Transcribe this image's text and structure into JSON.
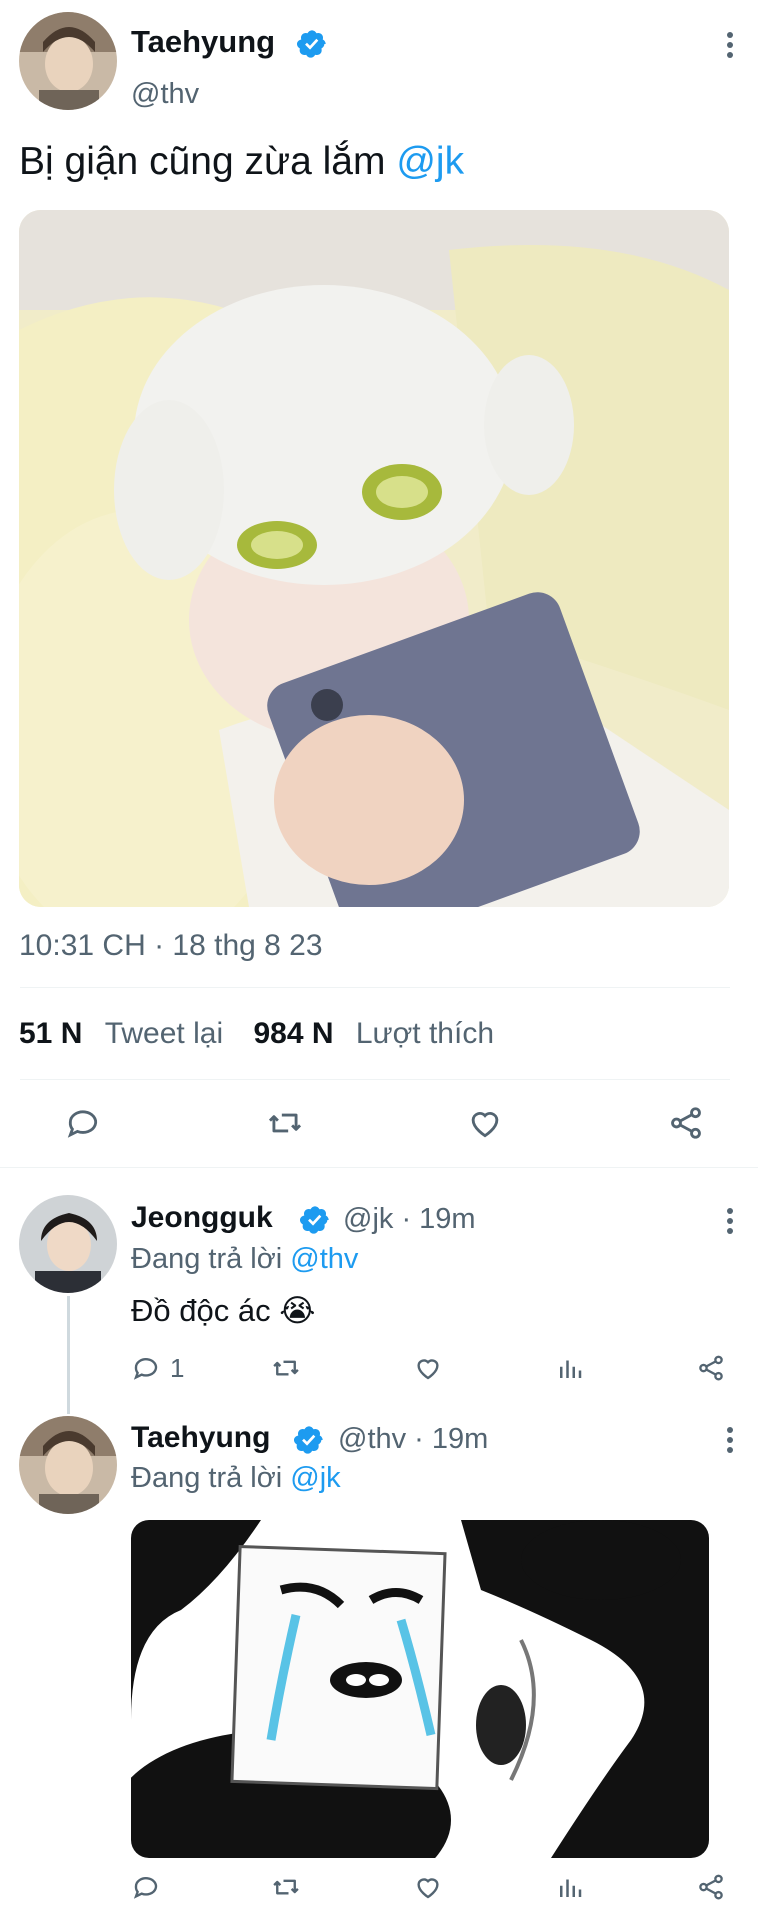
{
  "main_tweet": {
    "author_name": "Taehyung",
    "handle": "@thv",
    "text_prefix": "Bị giận cũng zừa lắm ",
    "mention": "@jk",
    "timestamp": "10:31 CH · 18 thg 8 23",
    "stats": {
      "retweet_count": "51 N",
      "retweet_label": "Tweet lại",
      "like_count": "984 N",
      "like_label": "Lượt thích"
    },
    "image_description": "baby-face-mask-phone-photo"
  },
  "replies": [
    {
      "author_name": "Jeongguk",
      "meta": "@jk · 19m",
      "replying_prefix": "Đang trả lời ",
      "replying_to": "@thv",
      "text": "Đồ độc ác 😭",
      "reply_count": "1"
    },
    {
      "author_name": "Taehyung",
      "meta": "@thv · 19m",
      "replying_prefix": "Đang trả lời ",
      "replying_to": "@jk"
    }
  ],
  "colors": {
    "accent": "#1d9bf0",
    "muted": "#536471",
    "divider": "#eff3f4"
  }
}
